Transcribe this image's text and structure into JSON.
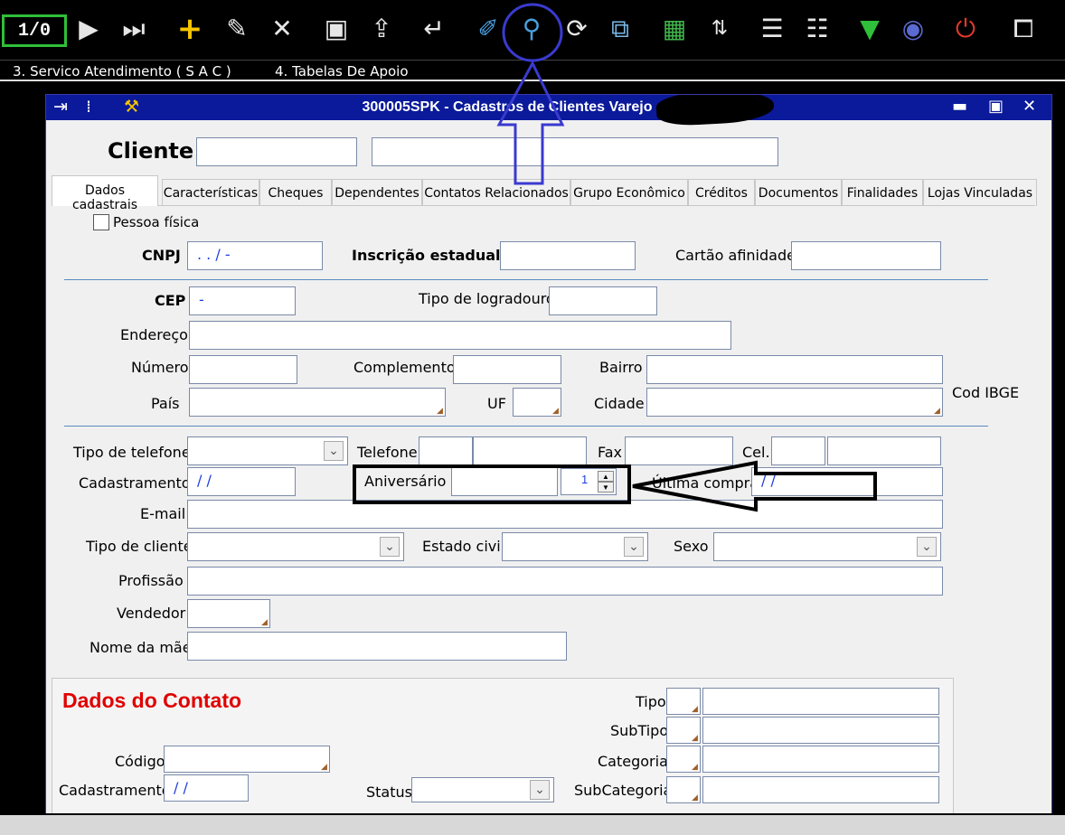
{
  "toolbar": {
    "record_counter": "1/0",
    "icons": [
      "next-icon",
      "last-icon",
      "add-icon",
      "edit-icon",
      "delete-icon",
      "save-icon",
      "copy-icon",
      "confirm-icon",
      "clear-icon",
      "search-icon",
      "refresh-icon",
      "preview-icon",
      "import-icon",
      "sort-icon",
      "add-list-icon",
      "remove-list-icon",
      "download-icon",
      "globe-icon",
      "power-icon",
      "monitor-icon"
    ]
  },
  "menu": {
    "item3": "3. Servico Atendimento ( S A C )",
    "item4": "4. Tabelas De Apoio"
  },
  "window": {
    "title": "300005SPK - Cadastros de Clientes Varejo",
    "title_bg": "#0a1a9a",
    "client_label": "Cliente"
  },
  "tabs": [
    "Dados cadastrais",
    "Características",
    "Cheques",
    "Dependentes",
    "Contatos Relacionados",
    "Grupo Econômico",
    "Créditos",
    "Documentos",
    "Finalidades",
    "Lojas Vinculadas"
  ],
  "form": {
    "pessoa_fisica": "Pessoa física",
    "cnpj_label": "CNPJ",
    "cnpj_value": ". . / -",
    "inscricao_label": "Inscrição estadual",
    "cartao_label": "Cartão afinidade",
    "cep_label": "CEP",
    "cep_value": "-",
    "tipo_logradouro_label": "Tipo de logradouro",
    "endereco_label": "Endereço",
    "numero_label": "Número",
    "complemento_label": "Complemento",
    "bairro_label": "Bairro",
    "pais_label": "País",
    "uf_label": "UF",
    "cidade_label": "Cidade",
    "cod_ibge_label": "Cod IBGE",
    "tipo_telefone_label": "Tipo de telefone",
    "telefone_label": "Telefone",
    "fax_label": "Fax",
    "cel_label": "Cel.",
    "cadastramento_label": "Cadastramento",
    "cadastramento_value": "/ /",
    "aniversario_label": "Aniversário",
    "aniversario_spin": "1",
    "ultima_compra_label": "Última compra",
    "ultima_compra_value": "/ /",
    "email_label": "E-mail",
    "tipo_cliente_label": "Tipo de cliente",
    "estado_civil_label": "Estado civil",
    "sexo_label": "Sexo",
    "profissao_label": "Profissão",
    "vendedor_label": "Vendedor",
    "nome_mae_label": "Nome da mãe"
  },
  "contact": {
    "title": "Dados do Contato",
    "title_color": "#e00000",
    "codigo_label": "Código",
    "cadastramento_label": "Cadastramento",
    "cadastramento_value": "/ /",
    "status_label": "Status",
    "tipo_label": "Tipo",
    "subtipo_label": "SubTipo",
    "categoria_label": "Categoria",
    "subcategoria_label": "SubCategoria"
  }
}
